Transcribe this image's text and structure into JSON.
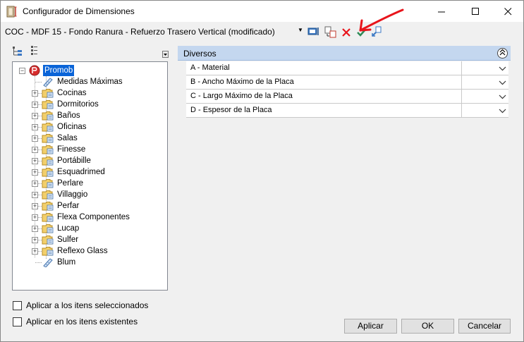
{
  "window": {
    "title": "Configurador de Dimensiones",
    "minimize": "—",
    "maximize": "☐",
    "close": "✕"
  },
  "toolbar": {
    "config_title": "COC - MDF 15 - Fondo Ranura - Refuerzo Trasero Vertical (modificado)",
    "dropdown_glyph": "▼"
  },
  "tree": {
    "root": "Promob",
    "items": [
      {
        "label": "Medidas Máximas",
        "expandable": false,
        "icon": "measure-icon"
      },
      {
        "label": "Cocinas",
        "expandable": true,
        "icon": "folder-icon"
      },
      {
        "label": "Dormitorios",
        "expandable": true,
        "icon": "folder-icon"
      },
      {
        "label": "Baños",
        "expandable": true,
        "icon": "folder-icon"
      },
      {
        "label": "Oficinas",
        "expandable": true,
        "icon": "folder-icon"
      },
      {
        "label": "Salas",
        "expandable": true,
        "icon": "folder-icon"
      },
      {
        "label": "Finesse",
        "expandable": true,
        "icon": "folder-icon"
      },
      {
        "label": "Portábille",
        "expandable": true,
        "icon": "folder-icon"
      },
      {
        "label": "Esquadrimed",
        "expandable": true,
        "icon": "folder-icon"
      },
      {
        "label": "Perlare",
        "expandable": true,
        "icon": "folder-icon"
      },
      {
        "label": "Villaggio",
        "expandable": true,
        "icon": "folder-icon"
      },
      {
        "label": "Perfar",
        "expandable": true,
        "icon": "folder-icon"
      },
      {
        "label": "Flexa Componentes",
        "expandable": true,
        "icon": "folder-icon"
      },
      {
        "label": "Lucap",
        "expandable": true,
        "icon": "folder-icon"
      },
      {
        "label": "Sulfer",
        "expandable": true,
        "icon": "folder-icon"
      },
      {
        "label": "Reflexo Glass",
        "expandable": true,
        "icon": "folder-icon"
      },
      {
        "label": "Blum",
        "expandable": false,
        "icon": "measure-icon"
      }
    ]
  },
  "options": {
    "apply_selected": "Aplicar a los itens seleccionados",
    "apply_existing": "Aplicar en los itens existentes"
  },
  "properties": {
    "section_title": "Diversos",
    "rows": [
      {
        "label": "A - Material",
        "value": ""
      },
      {
        "label": "B -  Ancho Máximo de la Placa",
        "value": ""
      },
      {
        "label": "C - Largo Máximo de la Placa",
        "value": ""
      },
      {
        "label": "D - Espesor de la Placa",
        "value": ""
      }
    ]
  },
  "buttons": {
    "apply": "Aplicar",
    "ok": "OK",
    "cancel": "Cancelar"
  },
  "colors": {
    "selection": "#0a64d8",
    "section_header": "#c4d7ef",
    "annotation_arrow": "#e8141b"
  }
}
